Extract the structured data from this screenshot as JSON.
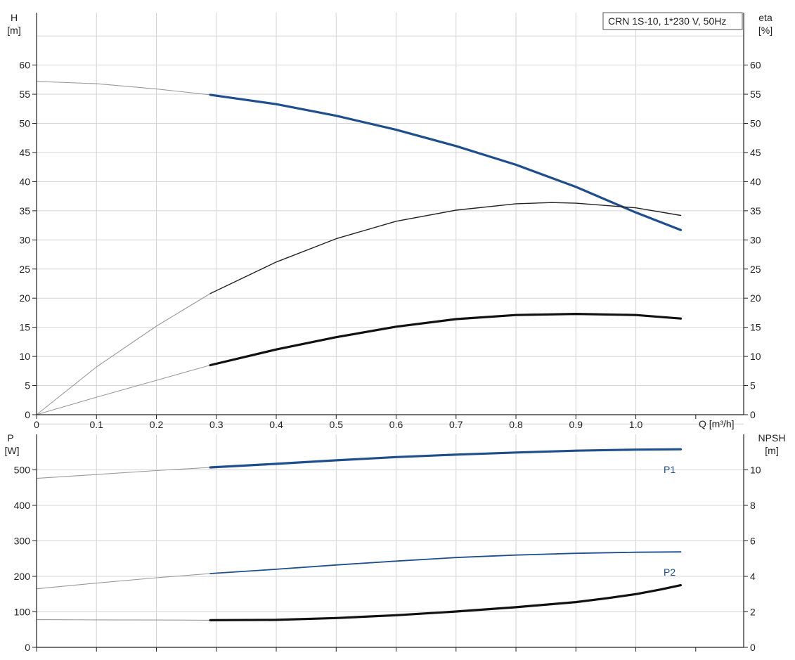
{
  "chart_data": [
    {
      "type": "line",
      "title": "CRN 1S-10, 1*230 V, 50Hz",
      "xlabel": "Q [m³/h]",
      "ylabel_left": [
        "H",
        "[m]"
      ],
      "ylabel_right": [
        "eta",
        "[%]"
      ],
      "xlim": [
        0,
        1.18
      ],
      "ylim_left": [
        0,
        69
      ],
      "ylim_right": [
        0,
        69
      ],
      "xticks": [
        "0",
        "0.1",
        "0.2",
        "0.3",
        "0.4",
        "0.5",
        "0.6",
        "0.7",
        "0.8",
        "0.9",
        "1.0"
      ],
      "yticks_left": [
        "0",
        "5",
        "10",
        "15",
        "20",
        "25",
        "30",
        "35",
        "40",
        "45",
        "50",
        "55",
        "60"
      ],
      "yticks_right": [
        "0",
        "5",
        "10",
        "15",
        "20",
        "25",
        "30",
        "35",
        "40",
        "45",
        "50",
        "55",
        "60"
      ],
      "grid": true,
      "duty_range": [
        0.29,
        1.075
      ],
      "series": [
        {
          "axis": "left",
          "color": "#1f4e8c",
          "weight": "bold",
          "x": [
            0,
            0.1,
            0.2,
            0.29,
            0.4,
            0.5,
            0.6,
            0.7,
            0.8,
            0.9,
            1.0,
            1.075
          ],
          "y": [
            57.2,
            56.8,
            55.9,
            54.9,
            53.3,
            51.3,
            48.9,
            46.1,
            42.9,
            39.1,
            34.7,
            31.7
          ]
        },
        {
          "axis": "right",
          "color": "#222222",
          "weight": "thin",
          "x": [
            0,
            0.1,
            0.2,
            0.29,
            0.4,
            0.5,
            0.6,
            0.7,
            0.8,
            0.86,
            0.9,
            1.0,
            1.075
          ],
          "y": [
            0,
            8.2,
            15.2,
            20.8,
            26.2,
            30.2,
            33.2,
            35.1,
            36.2,
            36.4,
            36.3,
            35.5,
            34.2
          ]
        },
        {
          "axis": "right",
          "color": "#111111",
          "weight": "bold",
          "x": [
            0,
            0.1,
            0.2,
            0.29,
            0.4,
            0.5,
            0.6,
            0.7,
            0.8,
            0.9,
            1.0,
            1.075
          ],
          "y": [
            0,
            3.0,
            5.9,
            8.5,
            11.2,
            13.3,
            15.1,
            16.4,
            17.1,
            17.3,
            17.1,
            16.5
          ]
        }
      ]
    },
    {
      "type": "line",
      "xlim": [
        0,
        1.18
      ],
      "ylabel_left": [
        "P",
        "[W]"
      ],
      "ylabel_right": [
        "NPSH",
        "[m]"
      ],
      "ylim_left": [
        0,
        600
      ],
      "ylim_right": [
        0,
        12
      ],
      "yticks_left": [
        "0",
        "100",
        "200",
        "300",
        "400",
        "500"
      ],
      "yticks_right": [
        "0",
        "2",
        "4",
        "6",
        "8",
        "10"
      ],
      "grid": true,
      "duty_range": [
        0.29,
        1.075
      ],
      "series": [
        {
          "name": "P1",
          "axis": "left",
          "color": "#1f4e8c",
          "weight": "bold",
          "x": [
            0,
            0.1,
            0.2,
            0.29,
            0.4,
            0.5,
            0.6,
            0.7,
            0.8,
            0.9,
            1.0,
            1.075
          ],
          "y": [
            476,
            487,
            498,
            507,
            517,
            527,
            536,
            543,
            549,
            554,
            557,
            558
          ]
        },
        {
          "name": "P2",
          "axis": "left",
          "color": "#1f4e8c",
          "weight": "medium",
          "x": [
            0,
            0.1,
            0.2,
            0.29,
            0.4,
            0.5,
            0.6,
            0.7,
            0.8,
            0.9,
            1.0,
            1.075
          ],
          "y": [
            165,
            181,
            196,
            208,
            220,
            232,
            243,
            253,
            260,
            265,
            268,
            269
          ]
        },
        {
          "axis": "right",
          "color": "#111111",
          "weight": "bold",
          "x": [
            0,
            0.1,
            0.2,
            0.29,
            0.4,
            0.5,
            0.6,
            0.7,
            0.8,
            0.9,
            0.95,
            1.0,
            1.04,
            1.075
          ],
          "y": [
            1.56,
            1.55,
            1.54,
            1.53,
            1.55,
            1.65,
            1.81,
            2.02,
            2.26,
            2.55,
            2.76,
            3.0,
            3.25,
            3.5
          ]
        }
      ]
    }
  ]
}
